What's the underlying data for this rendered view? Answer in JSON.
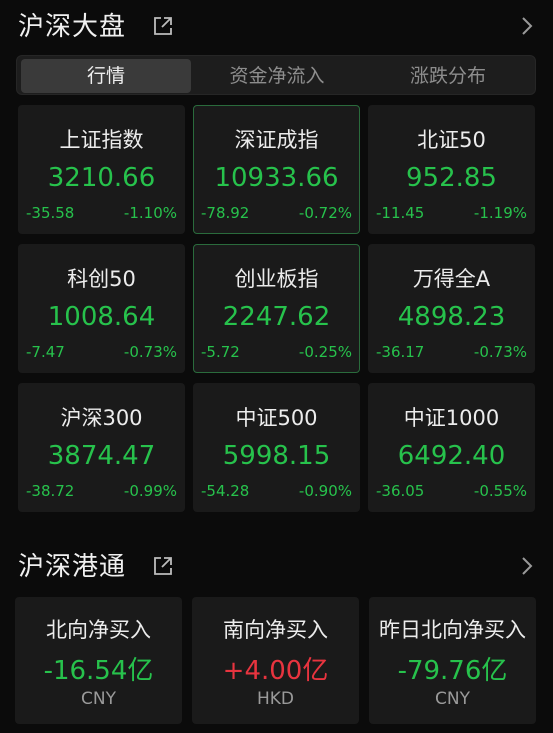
{
  "colors": {
    "down": "#27c24c",
    "up": "#e8343f",
    "selected_border": "#2a6b3c"
  },
  "market": {
    "title": "沪深大盘",
    "tabs": [
      {
        "label": "行情",
        "active": true
      },
      {
        "label": "资金净流入",
        "active": false
      },
      {
        "label": "涨跌分布",
        "active": false
      }
    ],
    "indices": [
      {
        "name": "上证指数",
        "value": "3210.66",
        "change": "-35.58",
        "pct": "-1.10%"
      },
      {
        "name": "深证成指",
        "value": "10933.66",
        "change": "-78.92",
        "pct": "-0.72%"
      },
      {
        "name": "北证50",
        "value": "952.85",
        "change": "-11.45",
        "pct": "-1.19%"
      },
      {
        "name": "科创50",
        "value": "1008.64",
        "change": "-7.47",
        "pct": "-0.73%"
      },
      {
        "name": "创业板指",
        "value": "2247.62",
        "change": "-5.72",
        "pct": "-0.25%"
      },
      {
        "name": "万得全A",
        "value": "4898.23",
        "change": "-36.17",
        "pct": "-0.73%"
      },
      {
        "name": "沪深300",
        "value": "3874.47",
        "change": "-38.72",
        "pct": "-0.99%"
      },
      {
        "name": "中证500",
        "value": "5998.15",
        "change": "-54.28",
        "pct": "-0.90%"
      },
      {
        "name": "中证1000",
        "value": "6492.40",
        "change": "-36.05",
        "pct": "-0.55%"
      }
    ]
  },
  "connect": {
    "title": "沪深港通",
    "items": [
      {
        "name": "北向净买入",
        "value": "-16.54亿",
        "unit": "CNY"
      },
      {
        "name": "南向净买入",
        "value": "+4.00亿",
        "unit": "HKD"
      },
      {
        "name": "昨日北向净买入",
        "value": "-79.76亿",
        "unit": "CNY"
      }
    ]
  }
}
